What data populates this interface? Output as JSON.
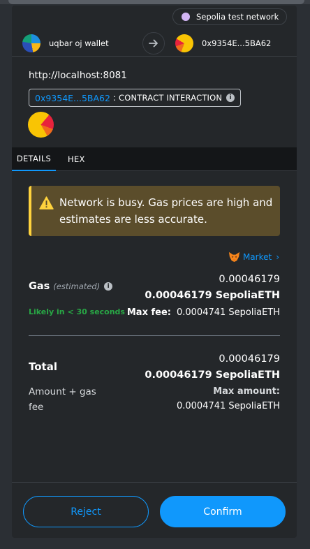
{
  "network": {
    "label": "Sepolia test network",
    "dot_color": "#d3b6f5"
  },
  "accounts": {
    "from": {
      "name": "uqbar oj wallet"
    },
    "to": {
      "name": "0x9354E...5BA62"
    }
  },
  "origin": "http://localhost:8081",
  "contract": {
    "address": "0x9354E...5BA62",
    "separator": ":",
    "type": "CONTRACT INTERACTION"
  },
  "tabs": [
    {
      "label": "DETAILS"
    },
    {
      "label": "HEX"
    }
  ],
  "warning": {
    "text": "Network is busy. Gas prices are high and estimates are less accurate."
  },
  "market": {
    "label": "Market"
  },
  "gas": {
    "label": "Gas",
    "estimated": "(estimated)",
    "amount": "0.00046179",
    "amount_currency": "0.00046179 SepoliaETH",
    "likely": "Likely in < 30 seconds",
    "max_fee_label": "Max fee:",
    "max_fee_value": "0.0004741 SepoliaETH"
  },
  "total": {
    "label": "Total",
    "sublabel": "Amount + gas fee",
    "amount": "0.00046179",
    "amount_currency": "0.00046179 SepoliaETH",
    "max_amount_label": "Max amount:",
    "max_amount_value": "0.0004741 SepoliaETH"
  },
  "buttons": {
    "reject": "Reject",
    "confirm": "Confirm"
  },
  "colors": {
    "accent": "#1098fc",
    "success": "#28a745",
    "warning_border": "#ffd33d",
    "warning_bg": "#5b4d2b"
  }
}
